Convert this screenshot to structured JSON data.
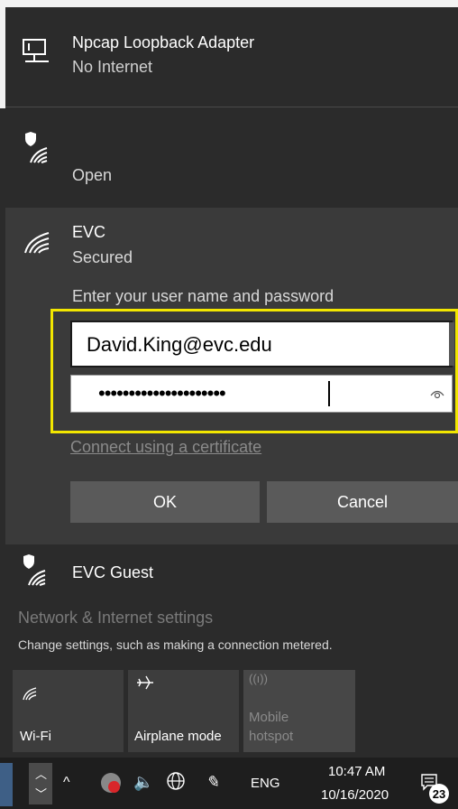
{
  "networks": {
    "loopback": {
      "name": "Npcap Loopback Adapter",
      "status": "No Internet"
    },
    "open_network": {
      "status": "Open"
    },
    "evc": {
      "name": "EVC",
      "status": "Secured",
      "prompt": "Enter your user name and password",
      "username_value": "David.King@evc.edu",
      "password_mask": "•••••••••••••••••••••",
      "cert_link": "Connect using a certificate",
      "ok_label": "OK",
      "cancel_label": "Cancel"
    },
    "guest": {
      "name": "EVC Guest"
    }
  },
  "settings": {
    "title": "Network & Internet settings",
    "description": "Change settings, such as making a connection metered."
  },
  "quick_actions": [
    {
      "label": "Wi-Fi",
      "icon": "wifi-icon"
    },
    {
      "label": "Airplane mode",
      "icon": "airplane-icon"
    },
    {
      "label_line1": "Mobile",
      "label_line2": "hotspot",
      "icon": "hotspot-icon"
    }
  ],
  "taskbar": {
    "language": "ENG",
    "time": "10:47 AM",
    "date": "10/16/2020",
    "notification_count": "23"
  },
  "colors": {
    "highlight_border": "#f2e600",
    "panel_bg": "#2b2b2b",
    "selected_bg": "#3a3a3a"
  }
}
